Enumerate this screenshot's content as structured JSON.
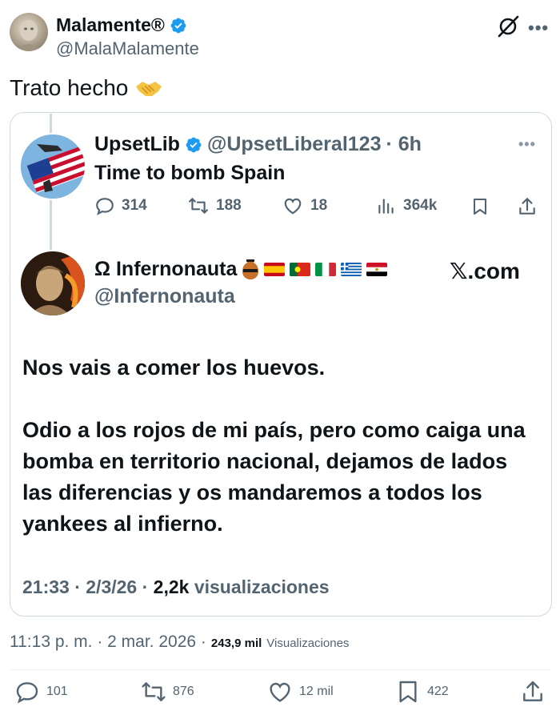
{
  "tweet": {
    "author_name": "Malamente®",
    "author_handle": "@MalaMalamente",
    "text": "Trato hecho",
    "emoji": "🤝",
    "timestamp": "11:13 p. m. · 2 mar. 2026 ·",
    "views_count": "243,9 mil",
    "views_label": "Visualizaciones",
    "actions": {
      "replies": "101",
      "reposts": "876",
      "likes": "12 mil",
      "bookmarks": "422"
    }
  },
  "quoted_parent": {
    "author_name": "UpsetLib",
    "author_handle": "@UpsetLiberal123",
    "time": "· 6h",
    "text": "Time to bomb Spain",
    "actions": {
      "replies": "314",
      "reposts": "188",
      "likes": "18",
      "views": "364k"
    }
  },
  "quoted_reply": {
    "author_name": "Ω Infernonauta",
    "author_handle": "@Infernonauta",
    "watermark": "𝕏.com",
    "paragraphs": [
      "Nos vais a comer los huevos.",
      "Odio a los rojos de mi país, pero como caiga una bomba en territorio nacional, dejamos de lados las diferencias y os mandaremos a todos los yankees al infierno."
    ],
    "meta_time": "21:33 · 2/3/26 ·",
    "meta_views": "2,2k",
    "meta_views_label": "visualizaciones"
  },
  "colors": {
    "text": "#0f1419",
    "secondary": "#536471",
    "verified": "#1d9bf0",
    "border": "#cfd9de"
  },
  "icons": [
    "verified-badge-icon",
    "grok-icon",
    "more-icon",
    "reply-icon",
    "repost-icon",
    "like-icon",
    "views-icon",
    "bookmark-icon",
    "share-icon",
    "handshake-icon",
    "amphora-icon"
  ]
}
